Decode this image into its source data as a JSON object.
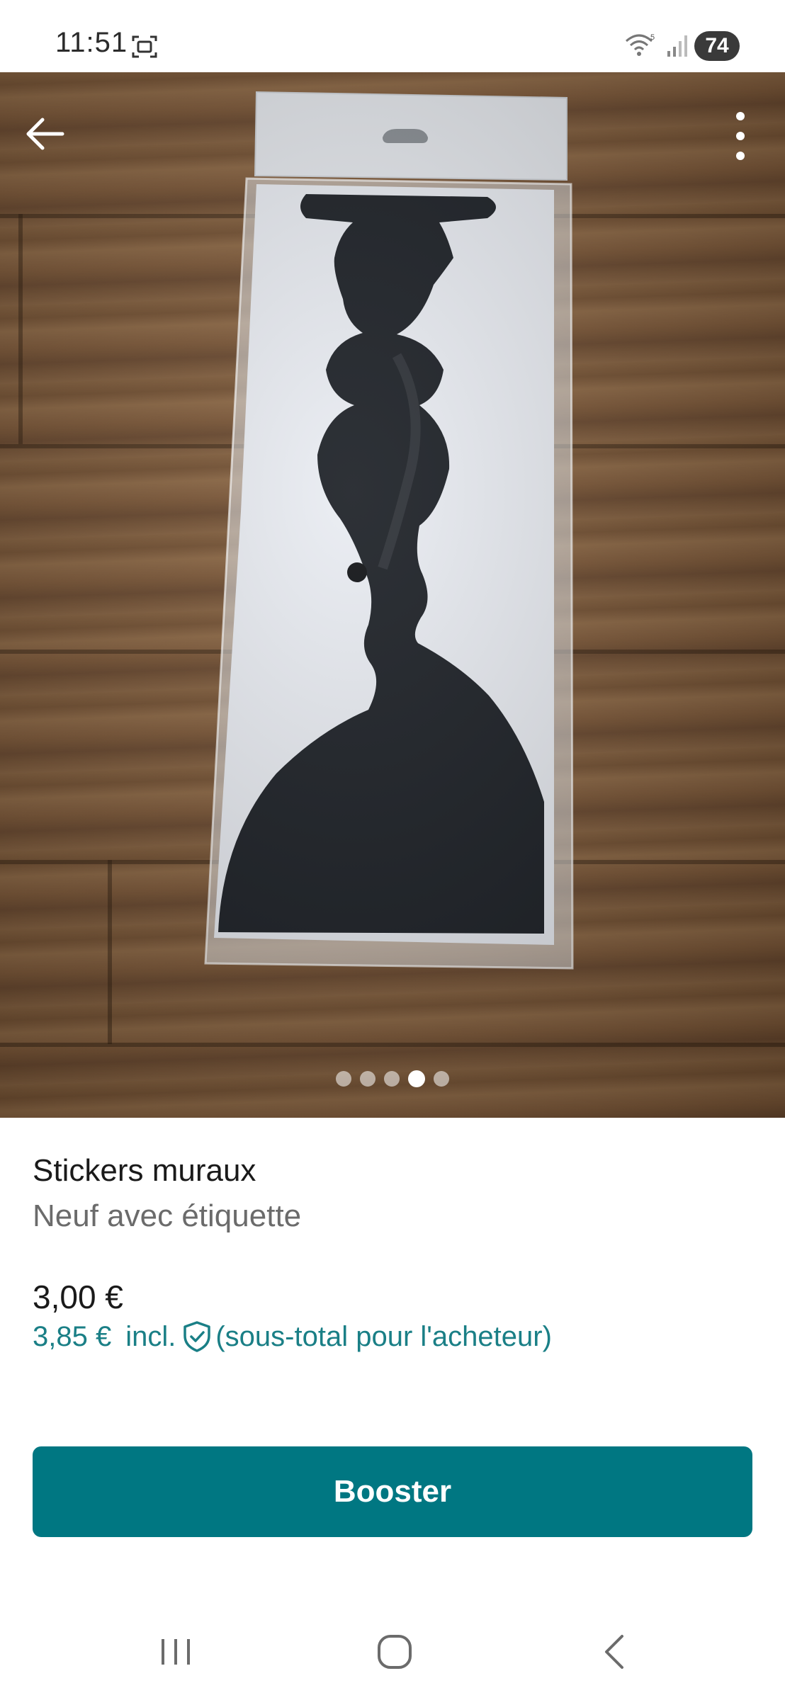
{
  "status_bar": {
    "time": "11:51",
    "battery": "74",
    "icons": [
      "screenshot-icon",
      "wifi-icon",
      "signal-icon"
    ]
  },
  "toolbar": {
    "back_icon": "arrow-left-icon",
    "more_icon": "more-vertical-icon"
  },
  "gallery": {
    "photo_count": 5,
    "active_index": 3
  },
  "item": {
    "title": "Stickers muraux",
    "condition": "Neuf avec étiquette",
    "price": "3,00 €",
    "buyer_price": "3,85 €",
    "buyer_incl": "incl.",
    "buyer_note": "(sous-total pour l'acheteur)"
  },
  "actions": {
    "boost_label": "Booster"
  },
  "colors": {
    "accent": "#007782",
    "buyer_price_text": "#1a7f86"
  }
}
